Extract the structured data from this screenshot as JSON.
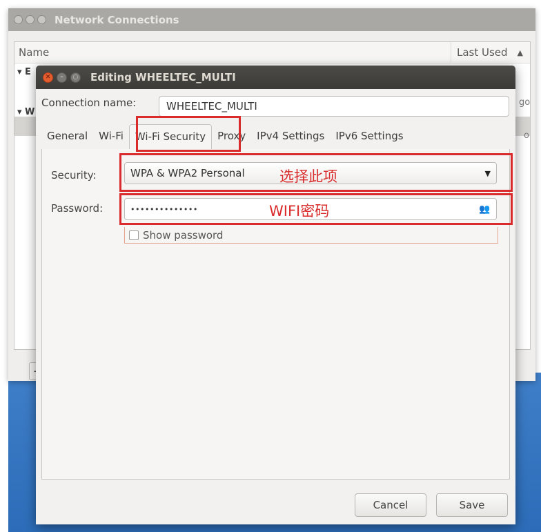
{
  "background_window": {
    "title": "Network Connections",
    "columns": {
      "name": "Name",
      "last_used": "Last Used"
    },
    "partial_rows": [
      "▾ E",
      "▾ W"
    ],
    "edge_text_1": "go",
    "edge_text_2": "o",
    "add_label": "+"
  },
  "dialog": {
    "title": "Editing WHEELTEC_MULTI",
    "connection_name_label": "Connection name:",
    "connection_name_value": "WHEELTEC_MULTI",
    "tabs": [
      {
        "label": "General"
      },
      {
        "label": "Wi-Fi"
      },
      {
        "label": "Wi-Fi Security"
      },
      {
        "label": "Proxy"
      },
      {
        "label": "IPv4 Settings"
      },
      {
        "label": "IPv6 Settings"
      }
    ],
    "active_tab": "Wi-Fi Security",
    "security_label": "Security:",
    "security_value": "WPA & WPA2 Personal",
    "password_label": "Password:",
    "password_value": "••••••••••••••",
    "show_password_label": "Show password",
    "show_password_checked": false,
    "cancel_label": "Cancel",
    "save_label": "Save"
  },
  "annotations": {
    "security_note": "选择此项",
    "password_note": "WIFI密码",
    "color": "#d92b2b"
  }
}
